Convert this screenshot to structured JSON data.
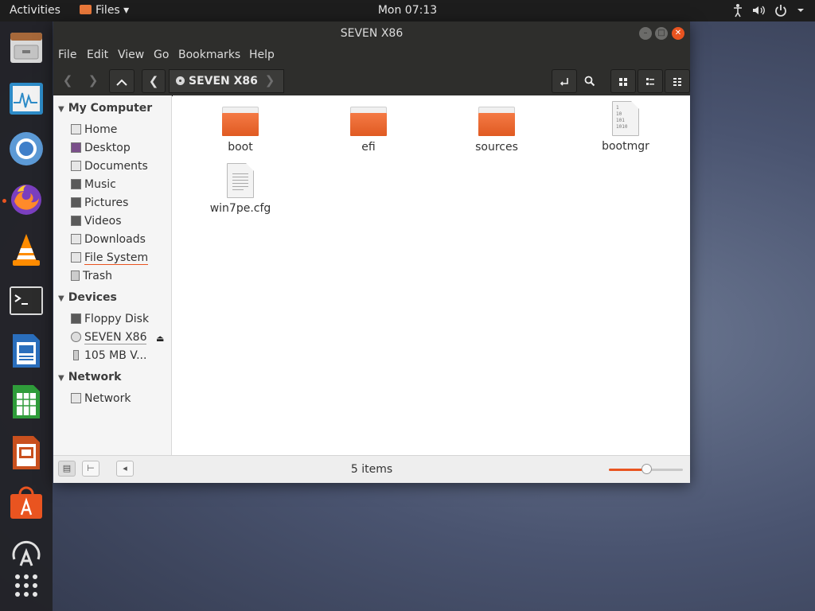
{
  "topbar": {
    "activities": "Activities",
    "app_menu": "Files ▾",
    "clock": "Mon 07:13",
    "tray_icons": [
      "accessibility-icon",
      "volume-icon",
      "power-icon",
      "chevron-down-icon"
    ]
  },
  "dock": {
    "items": [
      "file-cabinet-icon",
      "system-monitor-icon",
      "chromium-icon",
      "firefox-icon",
      "vlc-icon",
      "terminal-icon",
      "writer-icon",
      "calc-icon",
      "impress-icon",
      "software-center-icon",
      "update-icon",
      "show-apps-icon"
    ]
  },
  "window": {
    "title": "SEVEN X86",
    "menu": [
      "File",
      "Edit",
      "View",
      "Go",
      "Bookmarks",
      "Help"
    ],
    "breadcrumb": "SEVEN X86",
    "sidebar": {
      "my_computer": {
        "header": "My Computer",
        "items": [
          "Home",
          "Desktop",
          "Documents",
          "Music",
          "Pictures",
          "Videos",
          "Downloads",
          "File System",
          "Trash"
        ]
      },
      "devices": {
        "header": "Devices",
        "items": [
          "Floppy Disk",
          "SEVEN X86",
          "105 MB V..."
        ]
      },
      "network": {
        "header": "Network",
        "items": [
          "Network"
        ]
      }
    },
    "files": [
      {
        "name": "boot",
        "type": "folder"
      },
      {
        "name": "efi",
        "type": "folder"
      },
      {
        "name": "sources",
        "type": "folder"
      },
      {
        "name": "bootmgr",
        "type": "binary"
      },
      {
        "name": "win7pe.cfg",
        "type": "text"
      }
    ],
    "bin_glyph": "1\n10\n101\n1010",
    "status": "5 items",
    "zoom_fraction": 0.5,
    "colors": {
      "accent": "#e95420",
      "folder": "#f0743e",
      "titlebar": "#2e2e2c"
    }
  }
}
